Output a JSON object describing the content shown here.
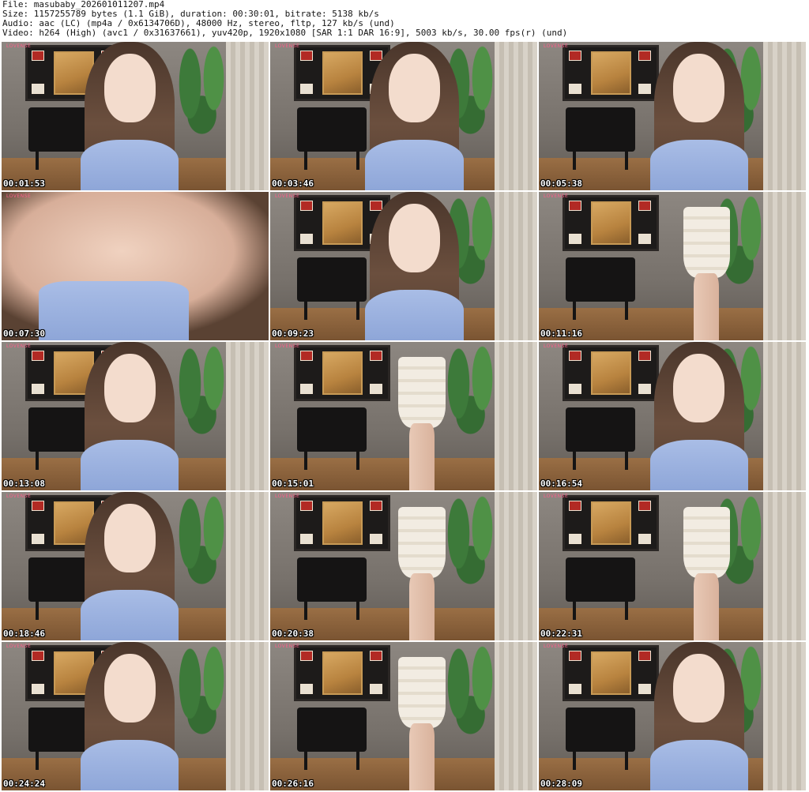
{
  "header": {
    "file": "File: masubaby_202601011207.mp4",
    "size": "Size: 1157255789 bytes (1.1 GiB), duration: 00:30:01, bitrate: 5138 kb/s",
    "audio": "Audio: aac (LC) (mp4a / 0x6134706D), 48000 Hz, stereo, fltp, 127 kb/s (und)",
    "video": "Video: h264 (High) (avc1 / 0x31637661), yuv420p, 1920x1080 [SAR 1:1 DAR 16:9], 5003 kb/s, 30.00 fps(r) (und)"
  },
  "thumbnails": [
    {
      "timestamp": "00:01:53",
      "scene": "portrait"
    },
    {
      "timestamp": "00:03:46",
      "scene": "portrait"
    },
    {
      "timestamp": "00:05:38",
      "scene": "portrait"
    },
    {
      "timestamp": "00:07:30",
      "scene": "closeup"
    },
    {
      "timestamp": "00:09:23",
      "scene": "portrait"
    },
    {
      "timestamp": "00:11:16",
      "scene": "skirt"
    },
    {
      "timestamp": "00:13:08",
      "scene": "portrait"
    },
    {
      "timestamp": "00:15:01",
      "scene": "skirt"
    },
    {
      "timestamp": "00:16:54",
      "scene": "portrait"
    },
    {
      "timestamp": "00:18:46",
      "scene": "portrait"
    },
    {
      "timestamp": "00:20:38",
      "scene": "skirt"
    },
    {
      "timestamp": "00:22:31",
      "scene": "skirt"
    },
    {
      "timestamp": "00:24:24",
      "scene": "portrait"
    },
    {
      "timestamp": "00:26:16",
      "scene": "skirt"
    },
    {
      "timestamp": "00:28:09",
      "scene": "portrait"
    }
  ],
  "watermark_text": "LOVENSE"
}
